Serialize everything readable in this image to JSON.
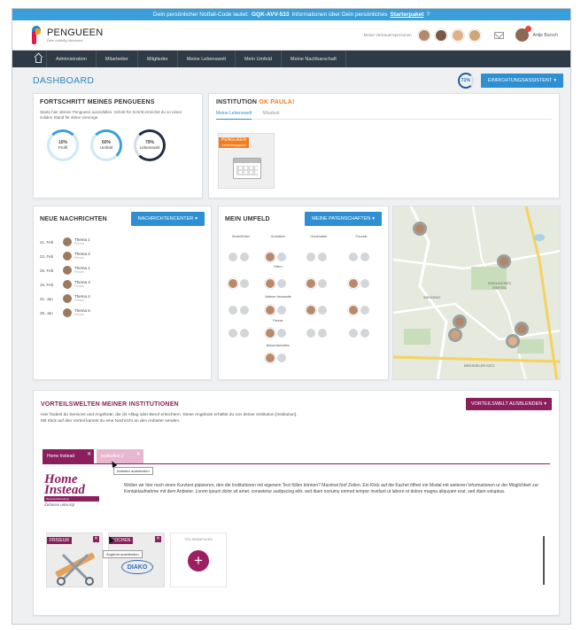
{
  "notice": {
    "pre": "Dein persönlicher Notfall-Code lautet:",
    "code": "GQK-AVV-533",
    "mid": "Informationen über Dein persönliches",
    "link": "Starterpaket",
    "post": "?"
  },
  "header": {
    "logo": "PENGUEEN",
    "logo_sub": "Dein Aufteilg-Netzwerk",
    "avatars_label": "Meine Vertrauenspersonen",
    "user": "Antje Bursch"
  },
  "nav": {
    "items": [
      "Administration",
      "Mitarbeiter",
      "Mitglieder",
      "Meine Lebenswelt",
      "Mein Umfeld",
      "Meine Nachbarschaft"
    ]
  },
  "dashboard": {
    "title": "DASHBOARD",
    "progress": "71%",
    "progress_value": 0.71,
    "wizard_button": "EINRICHTUNGSASSISTENT"
  },
  "progress_card": {
    "title": "FORTSCHRITT MEINES PENGUEENS",
    "desc": "Starte hier deinen Pengueen auszufüllen. Schritt für Schritt erreichst du so einen soliden Stand für deine Vorsorge.",
    "rings": [
      {
        "pct": "10%",
        "label": "Profil",
        "value": 0.1
      },
      {
        "pct": "60%",
        "label": "Umfeld",
        "value": 0.6
      },
      {
        "pct": "79%",
        "label": "Lebenswelt",
        "value": 0.79
      }
    ]
  },
  "institution": {
    "title": "INSTITUTION",
    "name": "OK PAULA!",
    "tabs": [
      "Meine Lebenswelt",
      "Mitarbeit"
    ],
    "tile_tag": "PENGUEEN",
    "tile_sub": "Vertretungsplan"
  },
  "messages": {
    "title": "NEUE NACHRICHTEN",
    "button": "NACHRICHTENCENTER",
    "rows": [
      {
        "date": "21. Feb",
        "title": "Thema 1",
        "sub": "Person"
      },
      {
        "date": "23. Feb",
        "title": "Thema 2",
        "sub": "Person"
      },
      {
        "date": "25. Feb",
        "title": "Thema 1",
        "sub": "Person"
      },
      {
        "date": "16. Feb",
        "title": "Thema 3",
        "sub": "Person"
      },
      {
        "date": "31. Jan",
        "title": "Thema 4",
        "sub": "Person"
      },
      {
        "date": "29. Jan",
        "title": "Thema 5",
        "sub": "Person"
      }
    ]
  },
  "umfeld": {
    "title": "MEIN UMFELD",
    "button": "MEINE PATENSCHAFTEN",
    "columns": [
      "Kinder/Enkel",
      "Großeltern",
      "Geschwister",
      "Freunde"
    ],
    "rows": [
      "Eltern",
      "Weitere Verwandte",
      "Partner",
      "Bekanntschaften"
    ]
  },
  "map": {
    "labels": [
      "ENGLISCHES VIERTEL",
      "WEDDING",
      "BRÜSSELER KIEZ"
    ]
  },
  "vorteile": {
    "title": "VORTEILSWELTEN MEINER INSTITUTIONEN",
    "button": "VORTEILSWELT AUSBLENDEN",
    "desc1": "Hier findest du Services und Angebote, die dir Alltag oder Beruf erleichtern. Diese Angebote erhältst du von deiner Institution [Institution].",
    "desc2": "Mit Klick auf den Vorteil kannst du eine Nachricht an den Anbieter senden.",
    "tabs": [
      "Home Instead",
      "Institution 2"
    ],
    "tip_provider": "Anbieter ausblenden",
    "logo_main": "Home Instead",
    "logo_band": "Seniorenbetreuung",
    "logo_slogan": "Zuhause umsorgt",
    "text": "Wollen wir hier noch einen Kurztext platzieren, den die Institutionen mit eigenem Text füllen können? Maximal fünf Zeilen. Ein Klick auf die Kachel öffnet ein Modal mit weiteren Informationen ur der Möglichkeit zur Kontaktaufnahme mit dem Anbieter. Lorem ipsum dolor sit amet, consetetur sadipscing elitr, sed diam nonumy eirmod tempor invidunt ut labore et dolore magna aliquyam erat, sed diam voluptua.",
    "tiles": [
      "FRISEUR",
      "KOCHEN"
    ],
    "tip_offer": "Angebot ausblenden",
    "add_label": "TEIL HINZUFÜGEN",
    "diako": "DIAKO"
  }
}
